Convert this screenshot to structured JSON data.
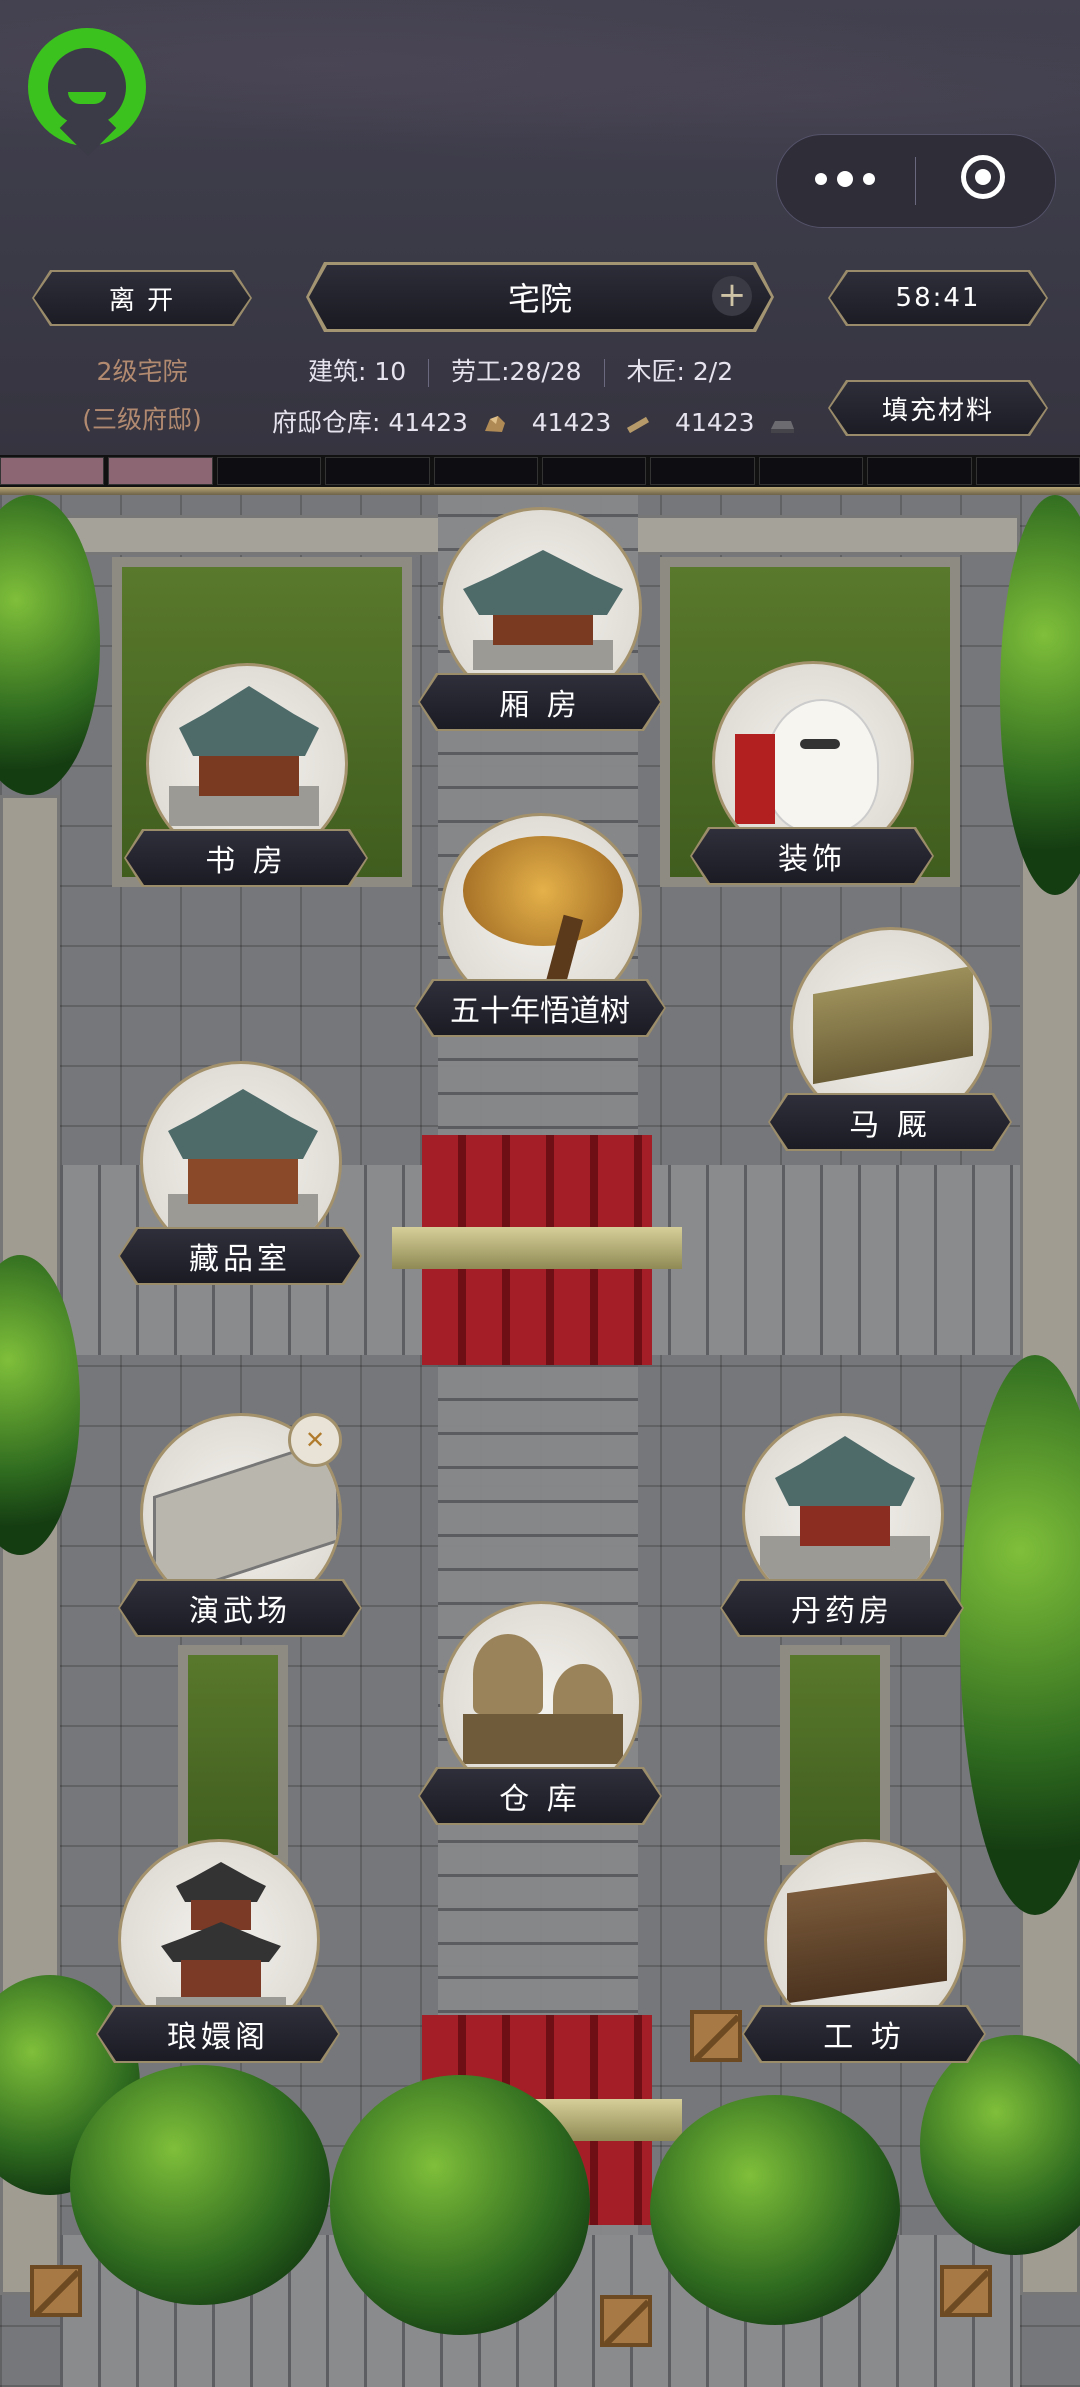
{
  "header": {
    "leave_label": "离 开",
    "title": "宅院",
    "timer": "58:41",
    "fill_label": "填充材料",
    "level_line1": "2级宅院",
    "level_line2": "(三级府邸)",
    "stats": {
      "build_label": "建筑:",
      "build_value": "10",
      "labor_label": "劳工:",
      "labor_value": "28/28",
      "carpenter_label": "木匠:",
      "carpenter_value": "2/2",
      "warehouse_label": "府邸仓库:",
      "res1": "41423",
      "res2": "41423",
      "res3": "41423"
    },
    "progress_filled": 2,
    "progress_total": 10
  },
  "buildings": [
    {
      "key": "wing",
      "label": "厢 房",
      "icon": "wing-room-icon"
    },
    {
      "key": "study",
      "label": "书 房",
      "icon": "study-icon"
    },
    {
      "key": "decor",
      "label": "装饰",
      "icon": "lucky-cat-icon"
    },
    {
      "key": "tree",
      "label": "五十年悟道树",
      "icon": "tree-icon"
    },
    {
      "key": "stable",
      "label": "马 厩",
      "icon": "stable-icon"
    },
    {
      "key": "collection",
      "label": "藏品室",
      "icon": "collection-room-icon"
    },
    {
      "key": "training",
      "label": "演武场",
      "icon": "training-ground-icon"
    },
    {
      "key": "alchemy",
      "label": "丹药房",
      "icon": "alchemy-room-icon"
    },
    {
      "key": "storage",
      "label": "仓 库",
      "icon": "storage-icon"
    },
    {
      "key": "pavilion",
      "label": "琅嬛阁",
      "icon": "pagoda-icon"
    },
    {
      "key": "workshop",
      "label": "工 坊",
      "icon": "workshop-icon"
    }
  ],
  "colors": {
    "accent_gold": "#9c8d6a",
    "progress_on": "#8c6672",
    "logo_green": "#3cc21f"
  }
}
